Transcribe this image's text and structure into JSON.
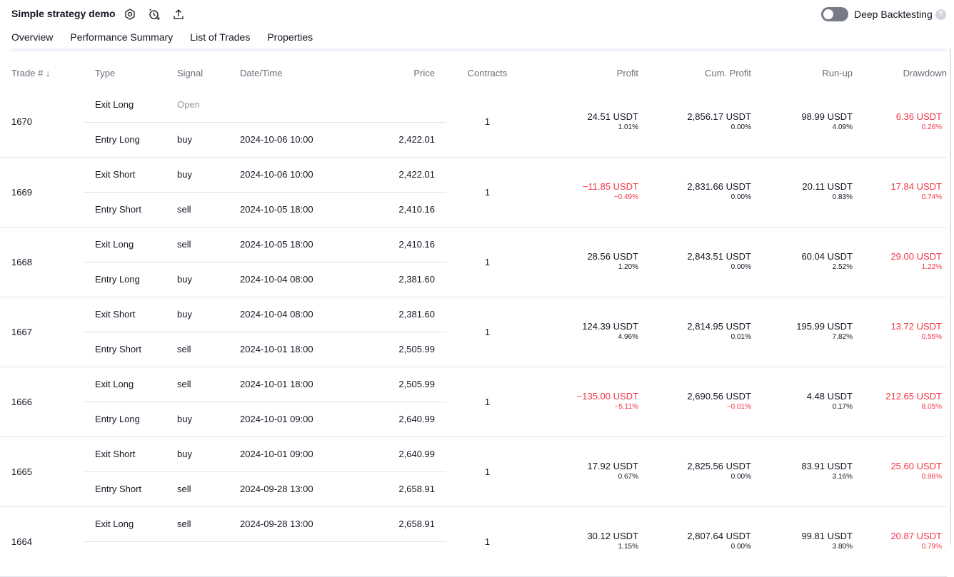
{
  "header": {
    "title": "Simple strategy demo",
    "deep_backtesting_label": "Deep Backtesting",
    "help": "?"
  },
  "tabs": [
    {
      "label": "Overview"
    },
    {
      "label": "Performance Summary"
    },
    {
      "label": "List of Trades"
    },
    {
      "label": "Properties"
    }
  ],
  "table": {
    "columns": {
      "trade": "Trade # ↓",
      "type": "Type",
      "signal": "Signal",
      "datetime": "Date/Time",
      "price": "Price",
      "contracts": "Contracts",
      "profit": "Profit",
      "cum_profit": "Cum. Profit",
      "runup": "Run-up",
      "drawdown": "Drawdown"
    },
    "trades": [
      {
        "num": "1670",
        "exit": {
          "type": "Exit Long",
          "signal": "Open",
          "datetime": "",
          "price": ""
        },
        "entry": {
          "type": "Entry Long",
          "signal": "buy",
          "datetime": "2024-10-06 10:00",
          "price": "2,422.01"
        },
        "contracts": "1",
        "profit": "24.51 USDT",
        "profit_pct": "1.01%",
        "cum_profit": "2,856.17 USDT",
        "cum_profit_pct": "0.00%",
        "runup": "98.99 USDT",
        "runup_pct": "4.09%",
        "drawdown": "6.36 USDT",
        "drawdown_pct": "0.26%"
      },
      {
        "num": "1669",
        "exit": {
          "type": "Exit Short",
          "signal": "buy",
          "datetime": "2024-10-06 10:00",
          "price": "2,422.01"
        },
        "entry": {
          "type": "Entry Short",
          "signal": "sell",
          "datetime": "2024-10-05 18:00",
          "price": "2,410.16"
        },
        "contracts": "1",
        "profit": "−11.85 USDT",
        "profit_pct": "−0.49%",
        "cum_profit": "2,831.66 USDT",
        "cum_profit_pct": "0.00%",
        "runup": "20.11 USDT",
        "runup_pct": "0.83%",
        "drawdown": "17.84 USDT",
        "drawdown_pct": "0.74%"
      },
      {
        "num": "1668",
        "exit": {
          "type": "Exit Long",
          "signal": "sell",
          "datetime": "2024-10-05 18:00",
          "price": "2,410.16"
        },
        "entry": {
          "type": "Entry Long",
          "signal": "buy",
          "datetime": "2024-10-04 08:00",
          "price": "2,381.60"
        },
        "contracts": "1",
        "profit": "28.56 USDT",
        "profit_pct": "1.20%",
        "cum_profit": "2,843.51 USDT",
        "cum_profit_pct": "0.00%",
        "runup": "60.04 USDT",
        "runup_pct": "2.52%",
        "drawdown": "29.00 USDT",
        "drawdown_pct": "1.22%"
      },
      {
        "num": "1667",
        "exit": {
          "type": "Exit Short",
          "signal": "buy",
          "datetime": "2024-10-04 08:00",
          "price": "2,381.60"
        },
        "entry": {
          "type": "Entry Short",
          "signal": "sell",
          "datetime": "2024-10-01 18:00",
          "price": "2,505.99"
        },
        "contracts": "1",
        "profit": "124.39 USDT",
        "profit_pct": "4.96%",
        "cum_profit": "2,814.95 USDT",
        "cum_profit_pct": "0.01%",
        "runup": "195.99 USDT",
        "runup_pct": "7.82%",
        "drawdown": "13.72 USDT",
        "drawdown_pct": "0.55%"
      },
      {
        "num": "1666",
        "exit": {
          "type": "Exit Long",
          "signal": "sell",
          "datetime": "2024-10-01 18:00",
          "price": "2,505.99"
        },
        "entry": {
          "type": "Entry Long",
          "signal": "buy",
          "datetime": "2024-10-01 09:00",
          "price": "2,640.99"
        },
        "contracts": "1",
        "profit": "−135.00 USDT",
        "profit_pct": "−5.11%",
        "cum_profit": "2,690.56 USDT",
        "cum_profit_pct": "−0.01%",
        "runup": "4.48 USDT",
        "runup_pct": "0.17%",
        "drawdown": "212.65 USDT",
        "drawdown_pct": "8.05%"
      },
      {
        "num": "1665",
        "exit": {
          "type": "Exit Short",
          "signal": "buy",
          "datetime": "2024-10-01 09:00",
          "price": "2,640.99"
        },
        "entry": {
          "type": "Entry Short",
          "signal": "sell",
          "datetime": "2024-09-28 13:00",
          "price": "2,658.91"
        },
        "contracts": "1",
        "profit": "17.92 USDT",
        "profit_pct": "0.67%",
        "cum_profit": "2,825.56 USDT",
        "cum_profit_pct": "0.00%",
        "runup": "83.91 USDT",
        "runup_pct": "3.16%",
        "drawdown": "25.60 USDT",
        "drawdown_pct": "0.96%"
      },
      {
        "num": "1664",
        "exit": {
          "type": "Exit Long",
          "signal": "sell",
          "datetime": "2024-09-28 13:00",
          "price": "2,658.91"
        },
        "entry": {
          "type": "",
          "signal": "",
          "datetime": "",
          "price": ""
        },
        "contracts": "1",
        "profit": "30.12 USDT",
        "profit_pct": "1.15%",
        "cum_profit": "2,807.64 USDT",
        "cum_profit_pct": "0.00%",
        "runup": "99.81 USDT",
        "runup_pct": "3.80%",
        "drawdown": "20.87 USDT",
        "drawdown_pct": "0.79%"
      }
    ]
  },
  "colors": {
    "negative": "#f23645",
    "text": "#131722",
    "muted": "#9598a1",
    "header_text": "#6a6d78"
  },
  "icons": [
    "settings-icon",
    "alert-add-icon",
    "share-upload-icon",
    "help-icon"
  ]
}
